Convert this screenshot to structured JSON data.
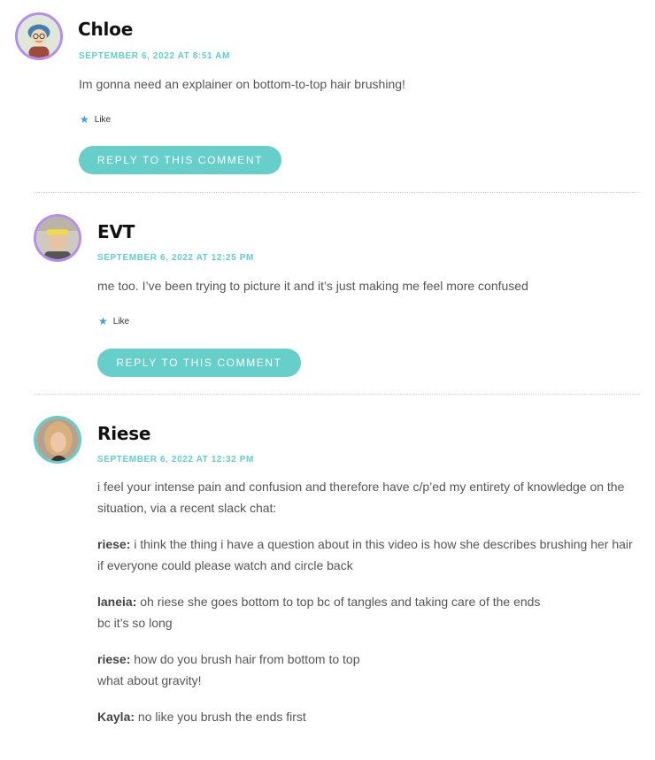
{
  "comments": [
    {
      "author": "Chloe",
      "date": "SEPTEMBER 6, 2022 AT 8:51 AM",
      "body": "Im gonna need an explainer on bottom-to-top hair brushing!",
      "like_label": "Like",
      "reply_label": "REPLY TO THIS COMMENT"
    },
    {
      "author": "EVT",
      "date": "SEPTEMBER 6, 2022 AT 12:25 PM",
      "body": "me too. I’ve been trying to picture it and it’s just making me feel more confused",
      "like_label": "Like",
      "reply_label": "REPLY TO THIS COMMENT"
    },
    {
      "author": "Riese",
      "date": "SEPTEMBER 6, 2022 AT 12:32 PM",
      "intro": "i feel your intense pain and confusion and therefore have c/p’ed my entirety of knowledge on the situation, via a recent slack chat:",
      "chat": [
        {
          "speaker": "riese:",
          "line1": "i think the thing i have a question about in this video is how she describes brushing her hair",
          "line2": "if everyone could please watch and circle back"
        },
        {
          "speaker": "laneia:",
          "line1": "oh riese she goes bottom to top bc of tangles and taking care of the ends",
          "line2": "bc it’s so long"
        },
        {
          "speaker": "riese:",
          "line1": "how do you brush hair from bottom to top",
          "line2": "what about gravity!"
        },
        {
          "speaker": "Kayla:",
          "line1": "no like you brush the ends first",
          "line2": ""
        }
      ]
    }
  ],
  "colors": {
    "accent_teal": "#66cfc9",
    "avatar_ring_purple": "#b58cf0",
    "like_star_blue": "#3fa0e0"
  },
  "icons": [
    "cartoon-avatar-icon",
    "photo-avatar-icon",
    "star-icon"
  ]
}
